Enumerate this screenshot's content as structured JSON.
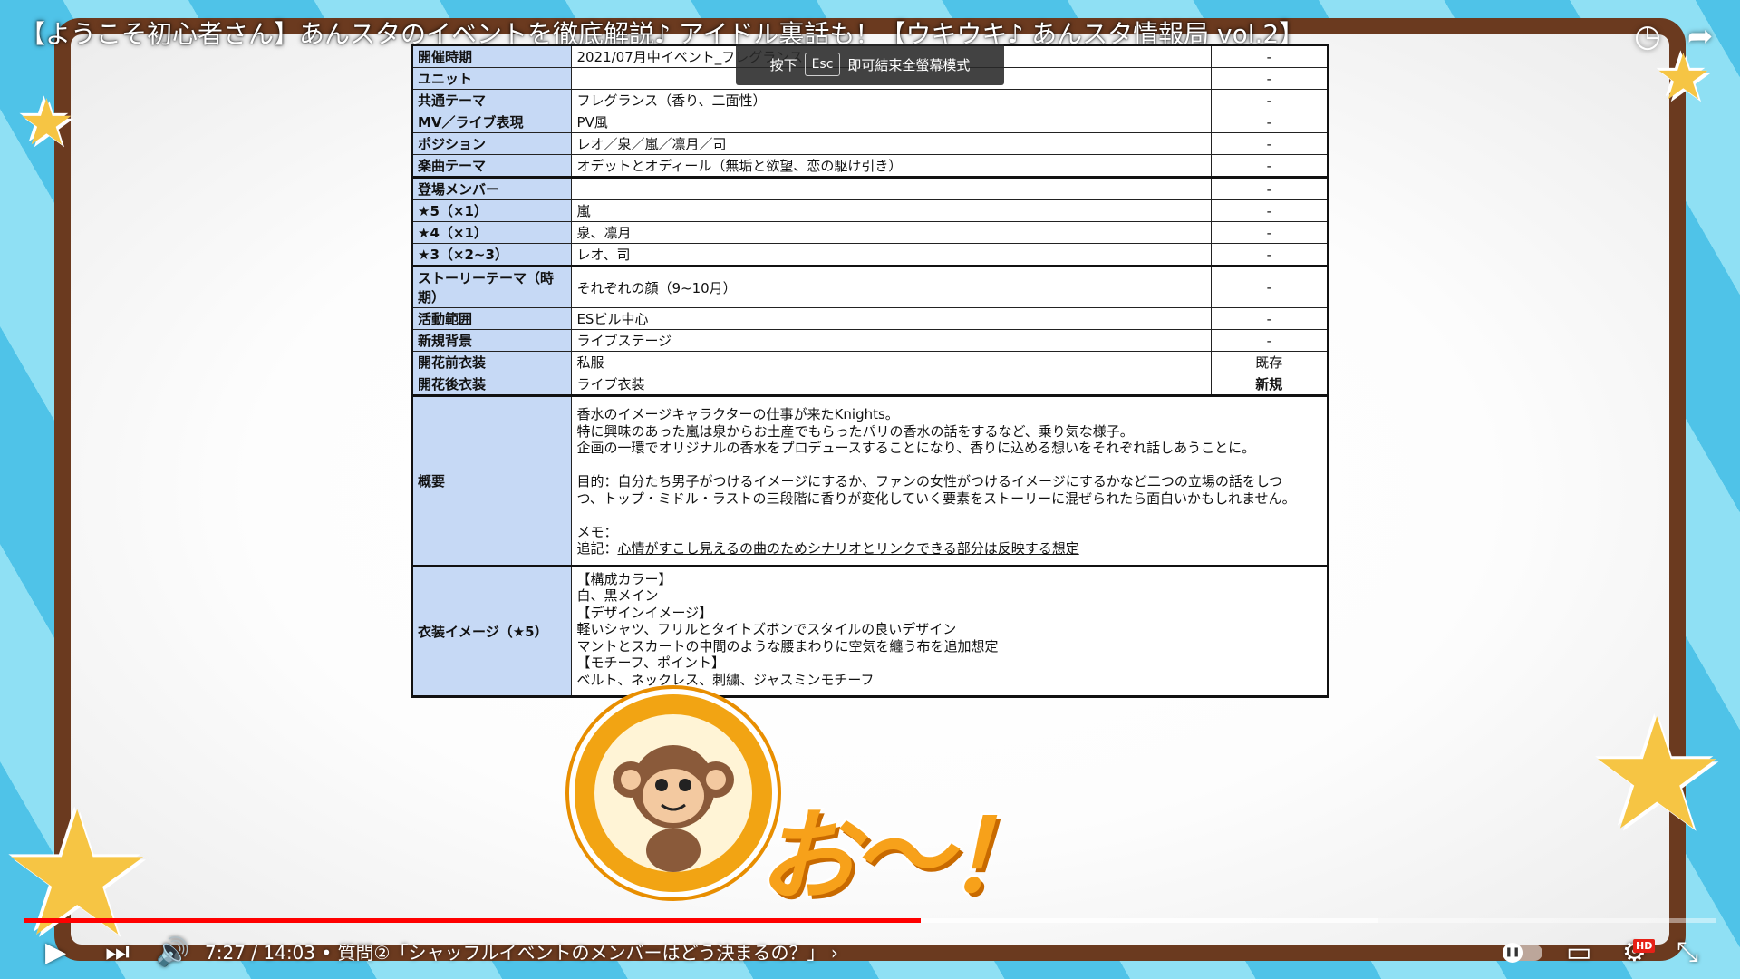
{
  "video": {
    "title": "【ようこそ初心者さん】あんスタのイベントを徹底解説♪ アイドル裏話も！【ウキウキ♪ あんスタ情報局 vol.2】"
  },
  "toast": {
    "prefix": "按下",
    "key": "Esc",
    "suffix": "即可結束全螢幕模式"
  },
  "table": {
    "rows": [
      {
        "label": "開催時期",
        "value": "2021/07月中イベント_フレグランス",
        "extra": "-"
      },
      {
        "label": "ユニット",
        "value": "",
        "extra": "-"
      },
      {
        "label": "共通テーマ",
        "value": "フレグランス（香り、二面性）",
        "extra": "-"
      },
      {
        "label": "MV／ライブ表現",
        "value": "PV風",
        "extra": "-"
      },
      {
        "label": "ポジション",
        "value": "レオ／泉／嵐／凛月／司",
        "extra": "-"
      },
      {
        "label": "楽曲テーマ",
        "value": "オデットとオディール（無垢と欲望、恋の駆け引き）",
        "extra": "-"
      },
      {
        "label": "登場メンバー",
        "value": "",
        "extra": "-"
      },
      {
        "label": "★5（×1）",
        "value": "嵐",
        "extra": "-"
      },
      {
        "label": "★4（×1）",
        "value": "泉、凛月",
        "extra": "-"
      },
      {
        "label": "★3（×2~3）",
        "value": "レオ、司",
        "extra": "-"
      },
      {
        "label": "ストーリーテーマ（時期）",
        "value": "それぞれの顔（9~10月）",
        "extra": "-"
      },
      {
        "label": "活動範囲",
        "value": "ESビル中心",
        "extra": "-"
      },
      {
        "label": "新規背景",
        "value": "ライブステージ",
        "extra": "-"
      },
      {
        "label": "開花前衣装",
        "value": "私服",
        "extra": "既存"
      },
      {
        "label": "開花後衣装",
        "value": "ライブ衣装",
        "extra": "新規"
      }
    ],
    "summary": {
      "label": "概要",
      "text": "香水のイメージキャラクターの仕事が来たKnights。\n特に興味のあった嵐は泉からお土産でもらったパリの香水の話をするなど、乗り気な様子。\n企画の一環でオリジナルの香水をプロデュースすることになり、香りに込める想いをそれぞれ話しあうことに。\n\n目的：自分たち男子がつけるイメージにするか、ファンの女性がつけるイメージにするかなど二つの立場の話をしつ\nつ、トップ・ミドル・ラストの三段階に香りが変化していく要素をストーリーに混ぜられたら面白いかもしれません。\n\nメモ：",
      "note_prefix": "追記：",
      "note_underlined": "心情がすこし見えるの曲のためシナリオとリンクできる部分は反映する想定"
    },
    "costume": {
      "label": "衣装イメージ（★5）",
      "text": "【構成カラー】\n白、黒メイン\n【デザインイメージ】\n軽いシャツ、フリルとタイトズボンでスタイルの良いデザイン\nマントとスカートの中間のような腰まわりに空気を纏う布を追加想定\n【モチーフ、ポイント】\nベルト、ネックレス、刺繍、ジャスミンモチーフ"
    }
  },
  "overlay": {
    "exclaim": "お～！"
  },
  "player": {
    "time": "7:27 / 14:03 • 質問②「シャッフルイベントのメンバーはどう決まるの？」",
    "chapter_chevron": "›",
    "played_fraction": 0.53,
    "hd_label": "HD",
    "icons": {
      "play": "play-icon",
      "next": "next-icon",
      "volume": "volume-icon",
      "autoplay": "autoplay-toggle",
      "subtitles": "subtitles-icon",
      "settings": "settings-icon",
      "exit_fullscreen": "exit-fullscreen-icon",
      "watch_later": "clock-icon",
      "share": "share-icon"
    },
    "accent_color": "#ff0000"
  }
}
